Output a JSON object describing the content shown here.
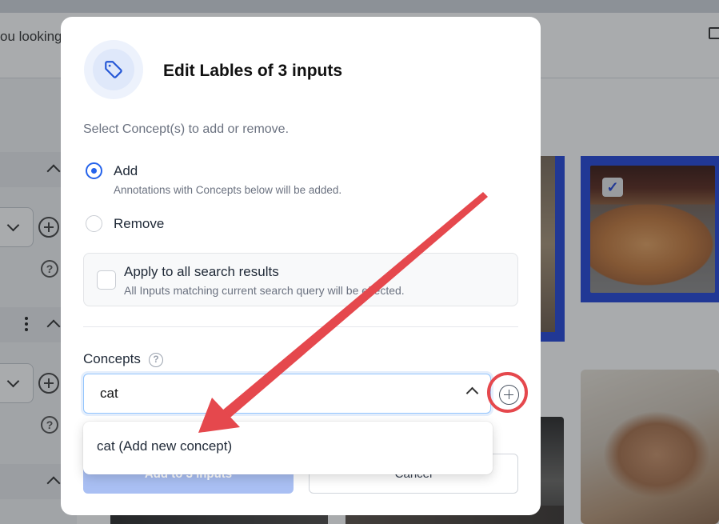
{
  "background": {
    "search_text": "ou looking"
  },
  "modal": {
    "title": "Edit Lables of 3 inputs",
    "subtitle": "Select Concept(s) to add or remove.",
    "mode_options": [
      {
        "label": "Add",
        "hint": "Annotations with Concepts below will be added.",
        "selected": true
      },
      {
        "label": "Remove",
        "hint": "",
        "selected": false
      }
    ],
    "apply_all": {
      "label": "Apply to all search results",
      "hint": "All Inputs matching current search query will be effected.",
      "checked": false
    },
    "concepts_label": "Concepts",
    "concepts_help": "?",
    "concept_input_value": "cat",
    "dropdown_option": "cat (Add new concept)",
    "primary_button": "Add to 3 inputs",
    "secondary_button": "Cancel"
  },
  "colors": {
    "accent": "#2563eb",
    "selection_border": "#2546d8",
    "annotation_red": "#e5484d",
    "primary_disabled": "#a9bff3"
  },
  "icons": {
    "header_icon": "tag-icon",
    "add_concept": "plus-circle-icon",
    "concepts_help": "question-circle-icon",
    "input_toggle": "chevron-up-icon",
    "selected_tile": "check-icon"
  },
  "annotation": {
    "type": "red arrow pointing from plus button to dropdown option, red circle around plus button"
  }
}
